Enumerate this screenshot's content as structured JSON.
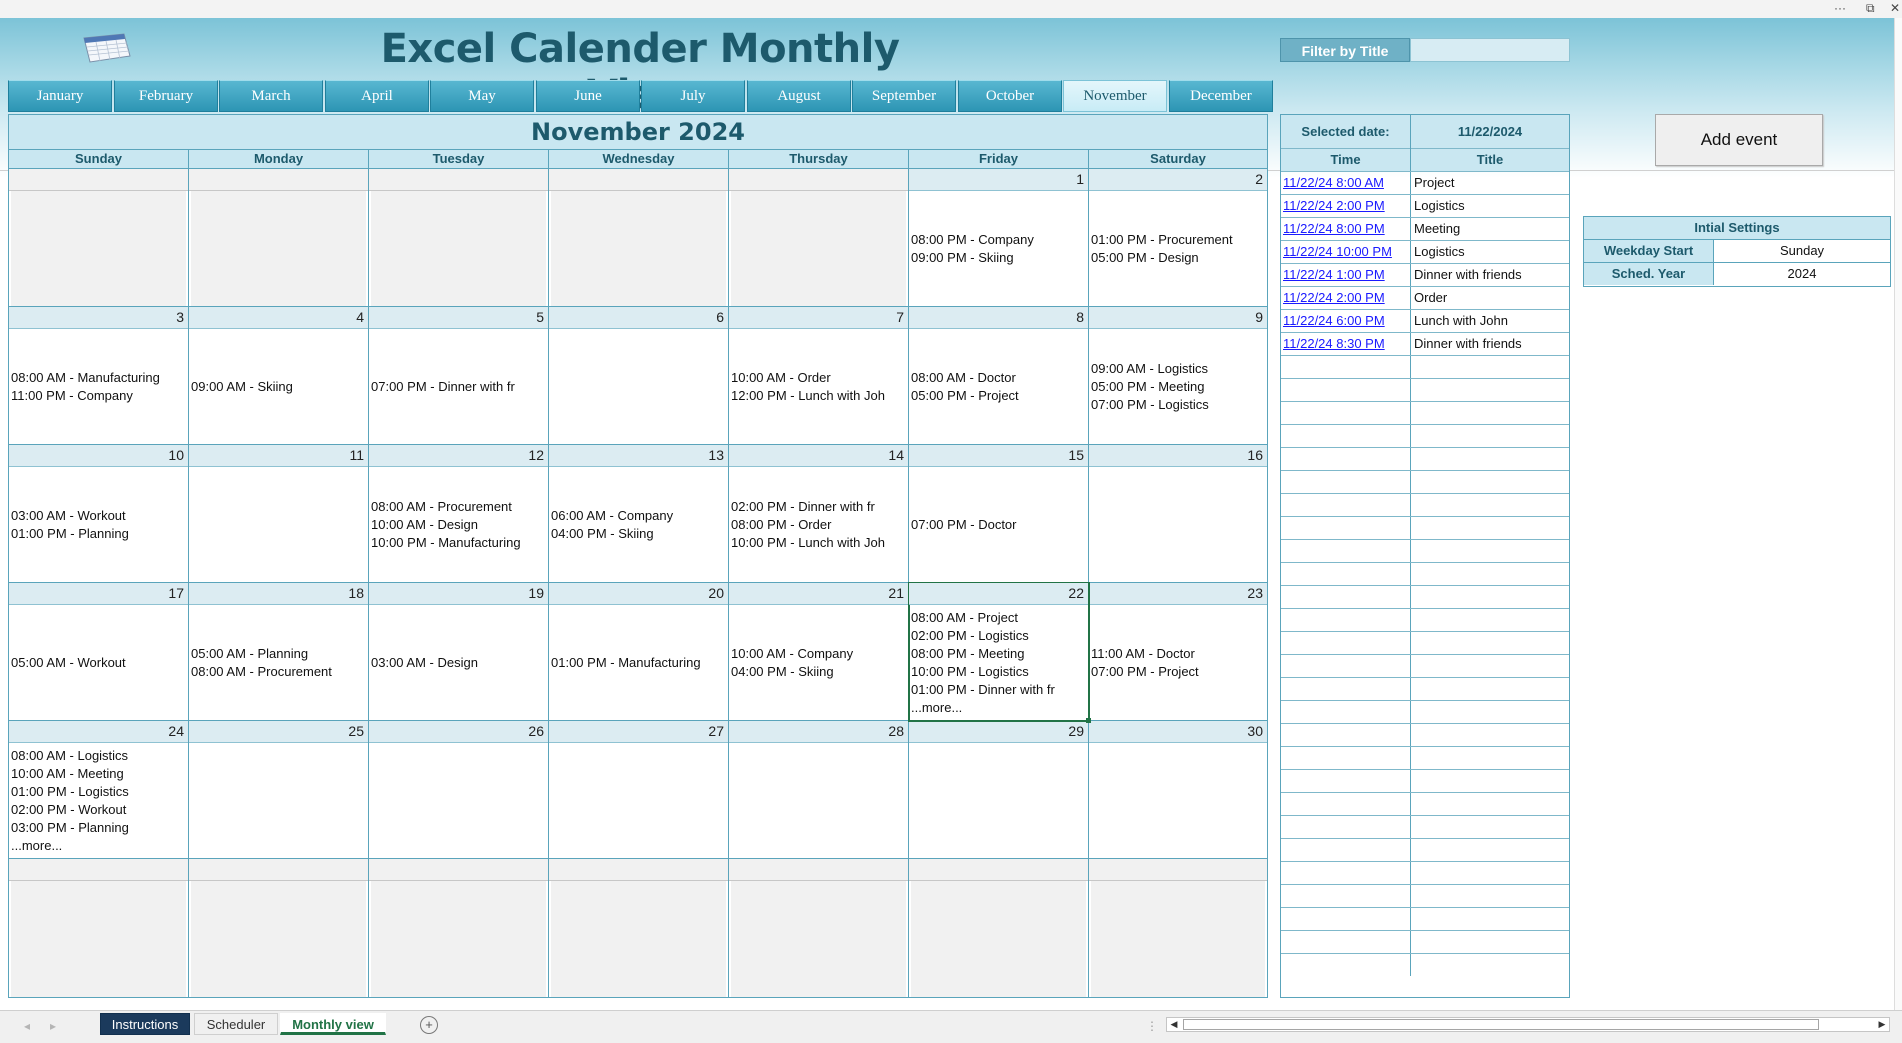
{
  "titlebar": {
    "more_icon": "more-icon",
    "window_icon": "restore-icon"
  },
  "header": {
    "title": "Excel Calender Monthly View",
    "filter_label": "Filter by Title",
    "filter_value": ""
  },
  "months": [
    "January",
    "February",
    "March",
    "April",
    "May",
    "June",
    "July",
    "August",
    "September",
    "October",
    "November",
    "December"
  ],
  "active_month_index": 10,
  "calendar": {
    "title": "November 2024",
    "weekdays": [
      "Sunday",
      "Monday",
      "Tuesday",
      "Wednesday",
      "Thursday",
      "Friday",
      "Saturday"
    ],
    "weeks": [
      [
        {
          "day": "",
          "events": []
        },
        {
          "day": "",
          "events": []
        },
        {
          "day": "",
          "events": []
        },
        {
          "day": "",
          "events": []
        },
        {
          "day": "",
          "events": []
        },
        {
          "day": "1",
          "events": [
            "08:00 PM - Company",
            "09:00 PM - Skiing"
          ]
        },
        {
          "day": "2",
          "events": [
            "01:00 PM - Procurement",
            "05:00 PM - Design"
          ]
        }
      ],
      [
        {
          "day": "3",
          "events": [
            "08:00 AM - Manufacturing",
            "11:00 PM - Company"
          ]
        },
        {
          "day": "4",
          "events": [
            "09:00 AM - Skiing"
          ]
        },
        {
          "day": "5",
          "events": [
            "07:00 PM - Dinner with fr"
          ]
        },
        {
          "day": "6",
          "events": []
        },
        {
          "day": "7",
          "events": [
            "10:00 AM - Order",
            "12:00 PM - Lunch with Joh"
          ]
        },
        {
          "day": "8",
          "events": [
            "08:00 AM - Doctor",
            "05:00 PM - Project"
          ]
        },
        {
          "day": "9",
          "events": [
            "09:00 AM - Logistics",
            "05:00 PM - Meeting",
            "07:00 PM - Logistics"
          ]
        }
      ],
      [
        {
          "day": "10",
          "events": [
            "03:00 AM - Workout",
            "01:00 PM - Planning"
          ]
        },
        {
          "day": "11",
          "events": []
        },
        {
          "day": "12",
          "events": [
            "08:00 AM - Procurement",
            "10:00 AM - Design",
            "10:00 PM - Manufacturing"
          ]
        },
        {
          "day": "13",
          "events": [
            "06:00 AM - Company",
            "04:00 PM - Skiing"
          ]
        },
        {
          "day": "14",
          "events": [
            "02:00 PM - Dinner with fr",
            "08:00 PM - Order",
            "10:00 PM - Lunch with Joh"
          ]
        },
        {
          "day": "15",
          "events": [
            "07:00 PM - Doctor"
          ]
        },
        {
          "day": "16",
          "events": []
        }
      ],
      [
        {
          "day": "17",
          "events": [
            "05:00 AM - Workout"
          ]
        },
        {
          "day": "18",
          "events": [
            "05:00 AM - Planning",
            "08:00 AM - Procurement"
          ]
        },
        {
          "day": "19",
          "events": [
            "03:00 AM - Design"
          ]
        },
        {
          "day": "20",
          "events": [
            "01:00 PM - Manufacturing"
          ]
        },
        {
          "day": "21",
          "events": [
            "10:00 AM - Company",
            "04:00 PM - Skiing"
          ]
        },
        {
          "day": "22",
          "events": [
            "08:00 AM - Project",
            "02:00 PM - Logistics",
            "08:00 PM - Meeting",
            "10:00 PM - Logistics",
            "01:00 PM - Dinner with fr",
            "...more..."
          ]
        },
        {
          "day": "23",
          "events": [
            "11:00 AM - Doctor",
            "07:00 PM - Project"
          ]
        }
      ],
      [
        {
          "day": "24",
          "events": [
            "08:00 AM - Logistics",
            "10:00 AM - Meeting",
            "01:00 PM - Logistics",
            "02:00 PM - Workout",
            "03:00 PM - Planning",
            "...more..."
          ]
        },
        {
          "day": "25",
          "events": []
        },
        {
          "day": "26",
          "events": []
        },
        {
          "day": "27",
          "events": []
        },
        {
          "day": "28",
          "events": []
        },
        {
          "day": "29",
          "events": []
        },
        {
          "day": "30",
          "events": []
        }
      ],
      [
        {
          "day": "",
          "events": []
        },
        {
          "day": "",
          "events": []
        },
        {
          "day": "",
          "events": []
        },
        {
          "day": "",
          "events": []
        },
        {
          "day": "",
          "events": []
        },
        {
          "day": "",
          "events": []
        },
        {
          "day": "",
          "events": []
        }
      ]
    ]
  },
  "selected": {
    "label": "Selected date:",
    "value": "11/22/2024",
    "col_time": "Time",
    "col_title": "Title",
    "rows": [
      {
        "time": "11/22/24 8:00 AM",
        "title": "Project"
      },
      {
        "time": "11/22/24 2:00 PM",
        "title": "Logistics"
      },
      {
        "time": "11/22/24 8:00 PM",
        "title": "Meeting"
      },
      {
        "time": "11/22/24 10:00 PM",
        "title": "Logistics"
      },
      {
        "time": "11/22/24 1:00 PM",
        "title": "Dinner with friends"
      },
      {
        "time": "11/22/24 2:00 PM",
        "title": "Order"
      },
      {
        "time": "11/22/24 6:00 PM",
        "title": "Lunch with John"
      },
      {
        "time": "11/22/24 8:30 PM",
        "title": "Dinner with friends"
      }
    ]
  },
  "add_event_label": "Add event",
  "settings": {
    "title": "Intial Settings",
    "rows": [
      {
        "key": "Weekday Start",
        "value": "Sunday"
      },
      {
        "key": "Sched. Year",
        "value": "2024"
      }
    ]
  },
  "sheet_tabs": [
    "Instructions",
    "Scheduler",
    "Monthly view"
  ],
  "active_sheet": "Monthly view",
  "colors": {
    "accent": "#1d5a6c",
    "tab": "#2d95b4",
    "border": "#5aa4bb",
    "excel_green": "#217346",
    "link": "#1a1aff"
  }
}
